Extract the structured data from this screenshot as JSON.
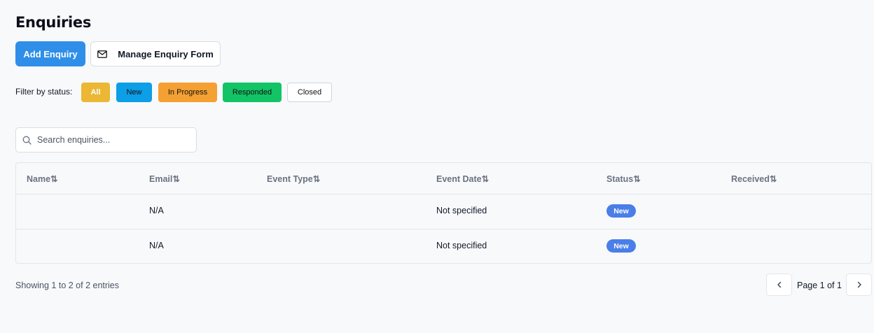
{
  "header": {
    "title": "Enquiries"
  },
  "toolbar": {
    "add_label": "Add Enquiry",
    "manage_label": "Manage Enquiry Form",
    "manage_icon": "mail-icon",
    "accent_color": "#2f8fe8"
  },
  "filters": {
    "label": "Filter by status:",
    "selected": "All",
    "options": [
      {
        "label": "All",
        "color": "#ebb734"
      },
      {
        "label": "New",
        "color": "#0d9ee8"
      },
      {
        "label": "In Progress",
        "color": "#f5a033"
      },
      {
        "label": "Responded",
        "color": "#12c465"
      },
      {
        "label": "Closed",
        "color": "#ffffff"
      }
    ]
  },
  "search": {
    "placeholder": "Search enquiries...",
    "value": "",
    "icon": "search-icon"
  },
  "table": {
    "sort_icon": "⇅",
    "columns": [
      "Name",
      "Email",
      "Event Type",
      "Event Date",
      "Status",
      "Received"
    ],
    "rows": [
      {
        "name": "",
        "email": "N/A",
        "event_type": "",
        "event_date": "Not specified",
        "status": "New",
        "received": ""
      },
      {
        "name": "",
        "email": "N/A",
        "event_type": "",
        "event_date": "Not specified",
        "status": "New",
        "received": ""
      }
    ],
    "status_badge_color": "#4a7ee8"
  },
  "pagination": {
    "info": "Showing 1 to 2 of 2 entries",
    "page_label": "Page 1 of 1",
    "prev_icon": "chevron-left-icon",
    "next_icon": "chevron-right-icon"
  }
}
